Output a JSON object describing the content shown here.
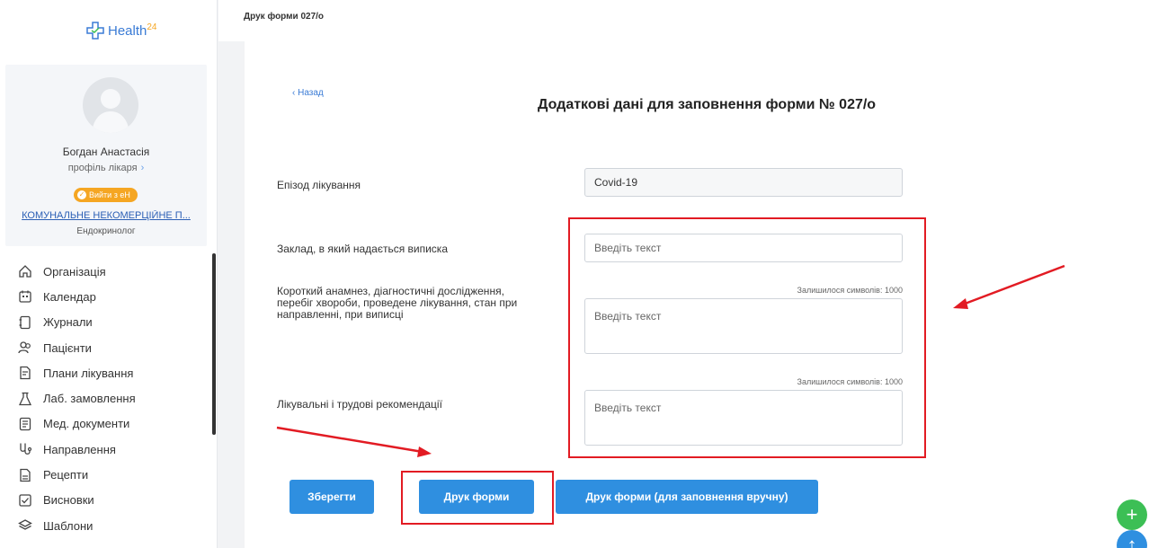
{
  "app": {
    "logo_text": "Health",
    "logo_sup": "24"
  },
  "profile": {
    "name": "Богдан Анастасія",
    "profile_link": "профіль лікаря",
    "eh_badge": "Вийти з еН",
    "organization": "КОМУНАЛЬНЕ НЕКОМЕРЦІЙНЕ П...",
    "specialty": "Ендокринолог"
  },
  "nav": {
    "items": [
      {
        "label": "Організація",
        "icon": "home-icon"
      },
      {
        "label": "Календар",
        "icon": "calendar-icon"
      },
      {
        "label": "Журнали",
        "icon": "journal-icon"
      },
      {
        "label": "Пацієнти",
        "icon": "patients-icon"
      },
      {
        "label": "Плани лікування",
        "icon": "treatment-plan-icon"
      },
      {
        "label": "Лаб. замовлення",
        "icon": "flask-icon"
      },
      {
        "label": "Мед. документи",
        "icon": "med-docs-icon"
      },
      {
        "label": "Направлення",
        "icon": "referral-icon"
      },
      {
        "label": "Рецепти",
        "icon": "prescription-icon"
      },
      {
        "label": "Висновки",
        "icon": "conclusion-icon"
      },
      {
        "label": "Шаблони",
        "icon": "templates-icon"
      }
    ]
  },
  "header": {
    "breadcrumb": "Друк форми 027/о"
  },
  "form": {
    "back_label": "‹ Назад",
    "title": "Додаткові дані для заповнення форми № 027/о",
    "episode_label": "Епізод лікування",
    "episode_value": "Covid-19",
    "facility_label": "Заклад, в який надається виписка",
    "facility_placeholder": "Введіть текст",
    "anamnesis_label": "Короткий анамнез, діагностичні дослідження, перебіг хвороби, проведене лікування, стан при направленні, при виписці",
    "anamnesis_counter": "Залишилося символів: 1000",
    "anamnesis_placeholder": "Введіть текст",
    "recommendations_label": "Лікувальні і трудові рекомендації",
    "recommendations_counter": "Залишилося символів: 1000",
    "recommendations_placeholder": "Введіть текст"
  },
  "buttons": {
    "save": "Зберегти",
    "print": "Друк форми",
    "print_manual": "Друк форми (для заповнення вручну)"
  },
  "colors": {
    "primary": "#2f8fe0",
    "accent_orange": "#f5a623",
    "annotation_red": "#e21b23",
    "fab_green": "#3cbf55"
  }
}
